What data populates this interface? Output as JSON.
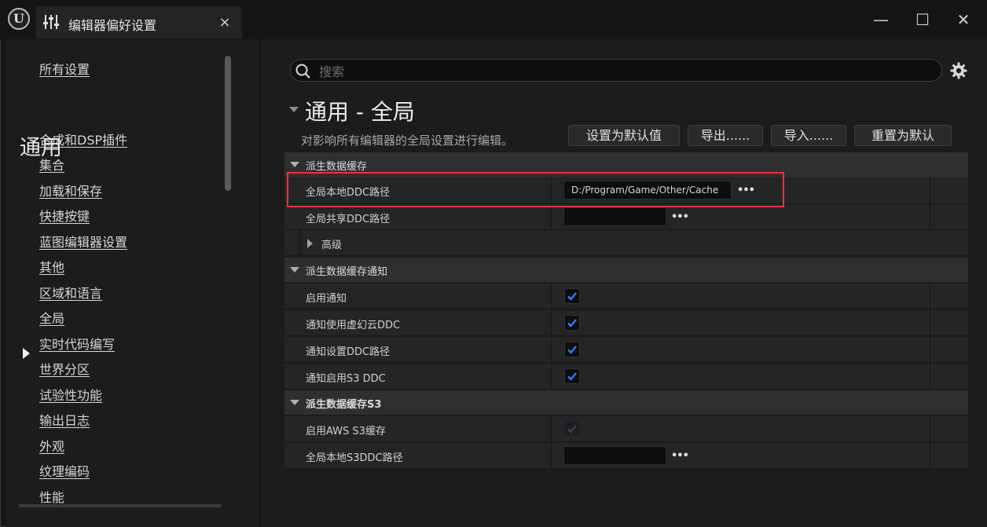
{
  "titlebar": {
    "logo_text": "U",
    "tab_title": "编辑器偏好设置",
    "tab_close": "×",
    "minimize": "—",
    "maximize": "☐",
    "close": "✕"
  },
  "sidebar": {
    "all_settings": "所有设置",
    "heading": "通用",
    "items": [
      {
        "label": "合成和DSP插件"
      },
      {
        "label": "集合"
      },
      {
        "label": "加载和保存"
      },
      {
        "label": "快捷按键"
      },
      {
        "label": "蓝图编辑器设置"
      },
      {
        "label": "其他"
      },
      {
        "label": "区域和语言"
      },
      {
        "label": "全局",
        "selected": true
      },
      {
        "label": "实时代码编写"
      },
      {
        "label": "世界分区"
      },
      {
        "label": "试验性功能"
      },
      {
        "label": "输出日志"
      },
      {
        "label": "外观"
      },
      {
        "label": "纹理编码"
      },
      {
        "label": "性能"
      }
    ]
  },
  "search": {
    "placeholder": "搜索",
    "value": ""
  },
  "section": {
    "title": "通用 - 全局",
    "description": "对影响所有编辑器的全局设置进行编辑。",
    "buttons": {
      "set_default": "设置为默认值",
      "export": "导出......",
      "import": "导入......",
      "reset": "重置为默认"
    }
  },
  "categories": {
    "ddc": {
      "label": "派生数据缓存",
      "local_path_label": "全局本地DDC路径",
      "local_path_value": "D:/Program/Game/Other/Cache",
      "shared_path_label": "全局共享DDC路径",
      "shared_path_value": "",
      "advanced_label": "高级"
    },
    "notify": {
      "label": "派生数据缓存通知",
      "rows": [
        {
          "label": "启用通知",
          "checked": true
        },
        {
          "label": "通知使用虚幻云DDC",
          "checked": true
        },
        {
          "label": "通知设置DDC路径",
          "checked": true
        },
        {
          "label": "通知启用S3 DDC",
          "checked": true
        }
      ]
    },
    "s3": {
      "label": "派生数据缓存S3",
      "enable_label": "启用AWS S3缓存",
      "enable_checked": true,
      "enable_disabled": true,
      "path_label": "全局本地S3DDC路径",
      "path_value": ""
    }
  },
  "browse_dots": "•••",
  "colors": {
    "highlight": "#e03a3a",
    "check": "#2a7fff",
    "check_disabled": "#3a4450"
  }
}
